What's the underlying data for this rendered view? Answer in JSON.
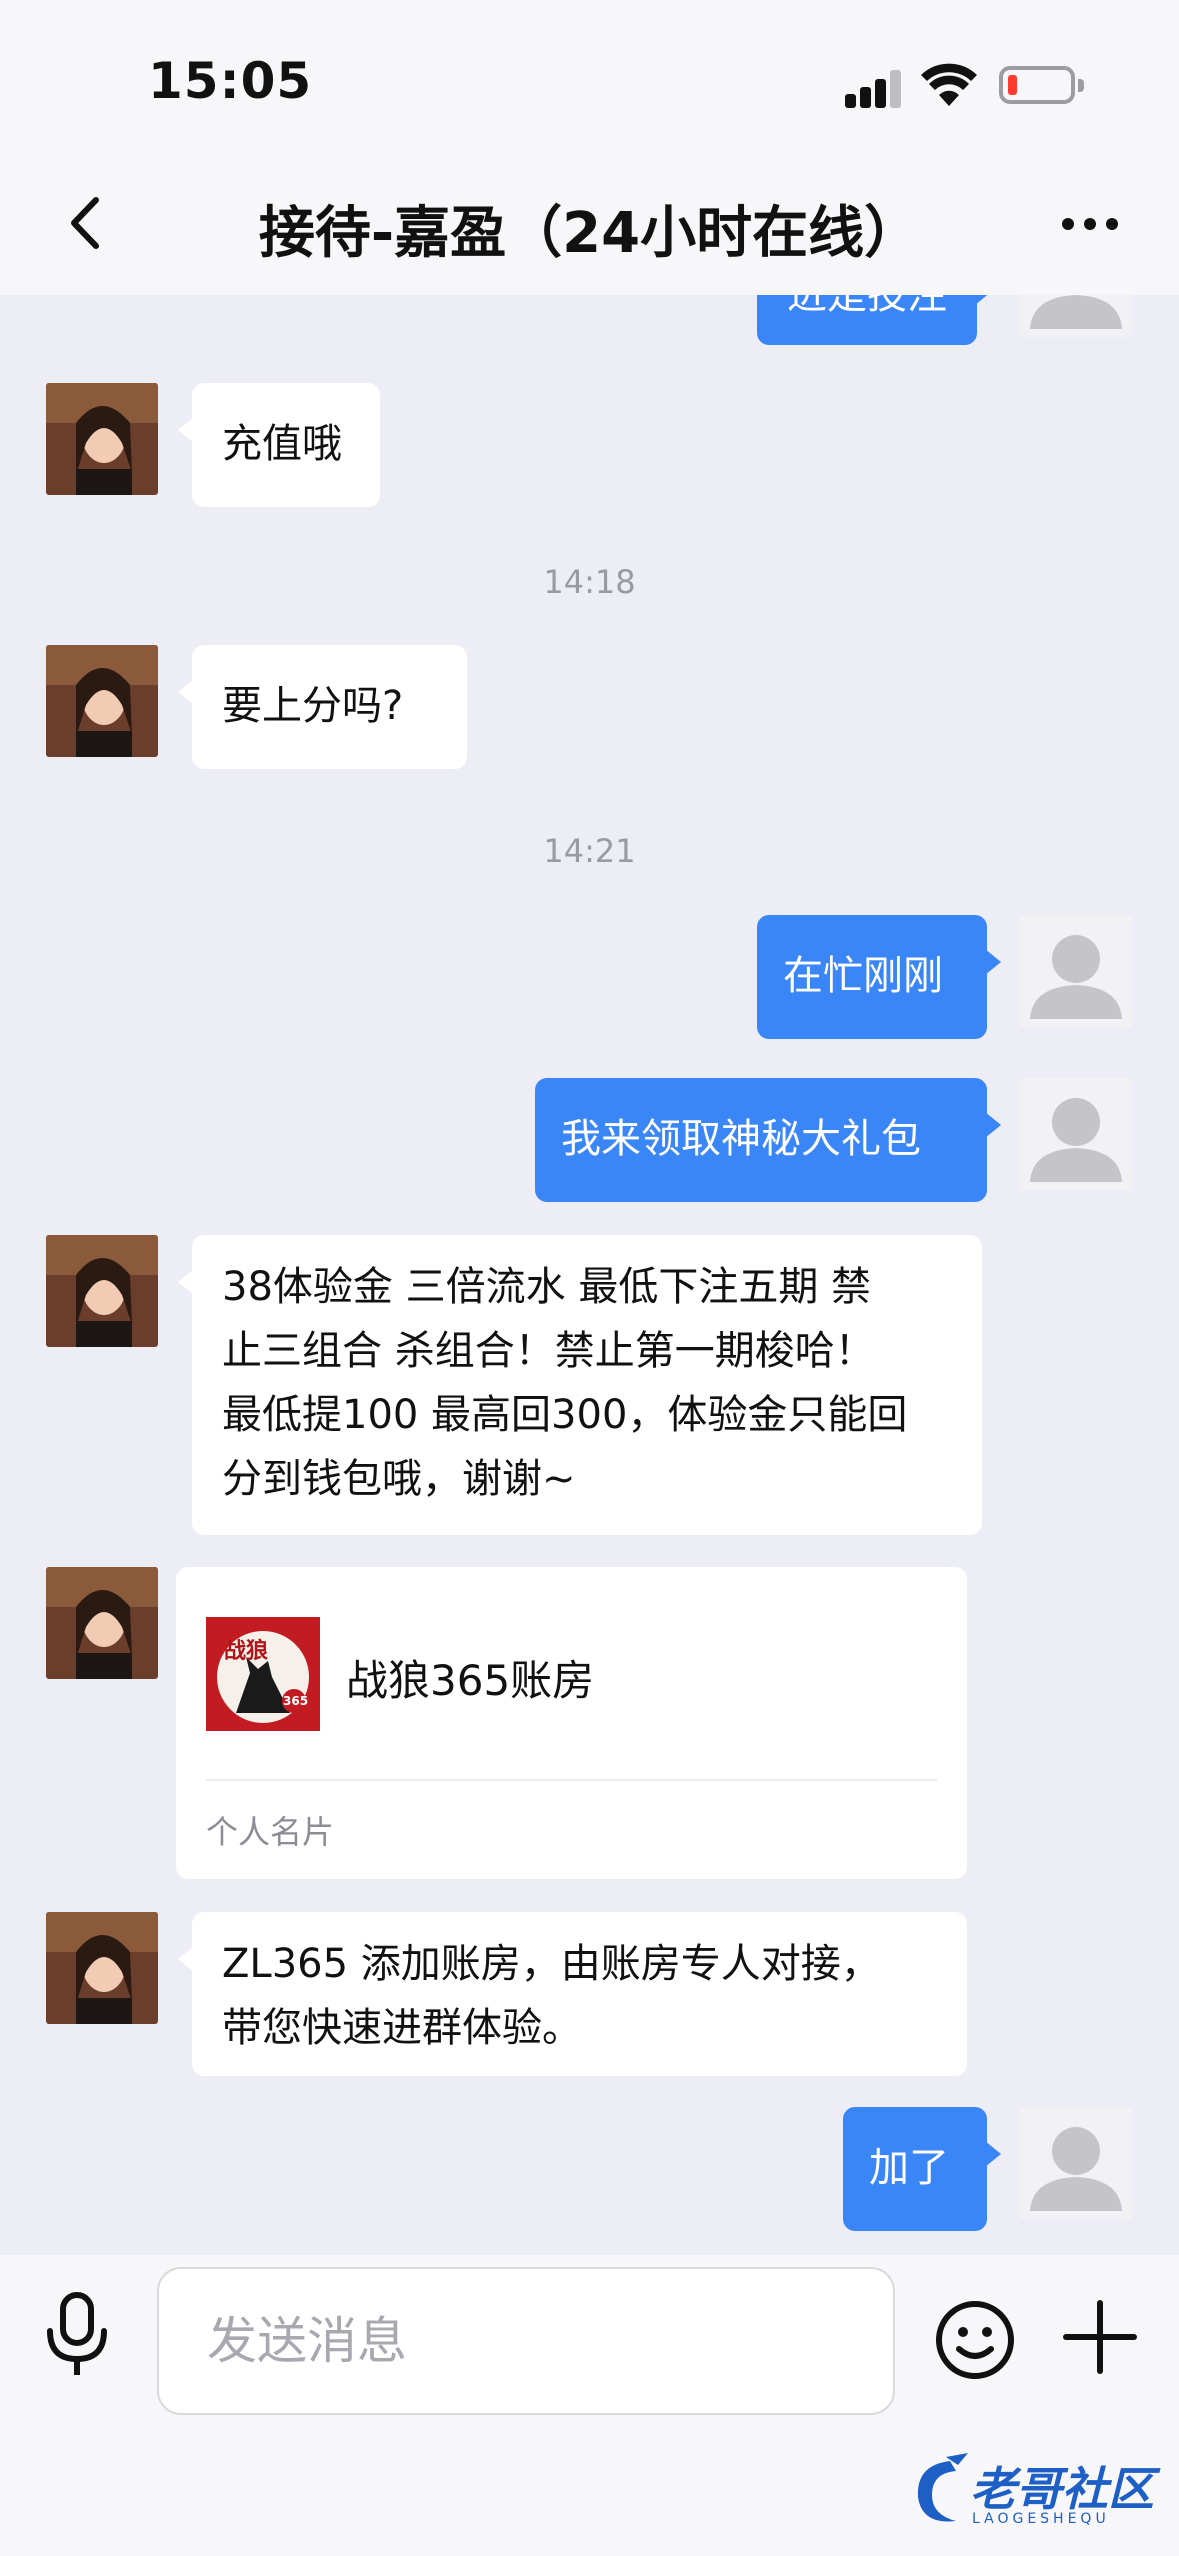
{
  "status_bar": {
    "time": "15:05",
    "battery_level_fraction": 0.08,
    "battery_color": "#ff3b30"
  },
  "nav": {
    "title": "接待-嘉盈（24小时在线）",
    "back_icon": "chevron-left-icon",
    "more_icon": "ellipsis-icon"
  },
  "messages": {
    "partial_top_out": "进是投注",
    "m1_in": "充值哦",
    "ts1": "14:18",
    "m2_in": "要上分吗?",
    "ts2": "14:21",
    "m3_out": "在忙刚刚",
    "m4_out": "我来领取神秘大礼包",
    "m5_in_lines": [
      "38体验金  三倍流水 最低下注五期 禁",
      "止三组合 杀组合！禁止第一期梭哈！",
      "最低提100 最高回300，体验金只能回",
      "分到钱包哦，谢谢~"
    ],
    "card": {
      "name": "战狼365账房",
      "label": "个人名片",
      "logo_text": "战狼",
      "logo_badge": "365"
    },
    "m6_in_lines": [
      "ZL365 添加账房，由账房专人对接，",
      "带您快速进群体验。"
    ],
    "m7_out": "加了"
  },
  "input_bar": {
    "placeholder": "发送消息",
    "mic_icon": "microphone-icon",
    "emoji_icon": "smiley-icon",
    "plus_icon": "plus-icon"
  },
  "watermark": {
    "text": "老哥社区",
    "sub": "LAOGESHEQU"
  },
  "colors": {
    "outgoing_bubble": "#3a86f6",
    "incoming_bubble": "#ffffff",
    "background": "#ededf5"
  }
}
